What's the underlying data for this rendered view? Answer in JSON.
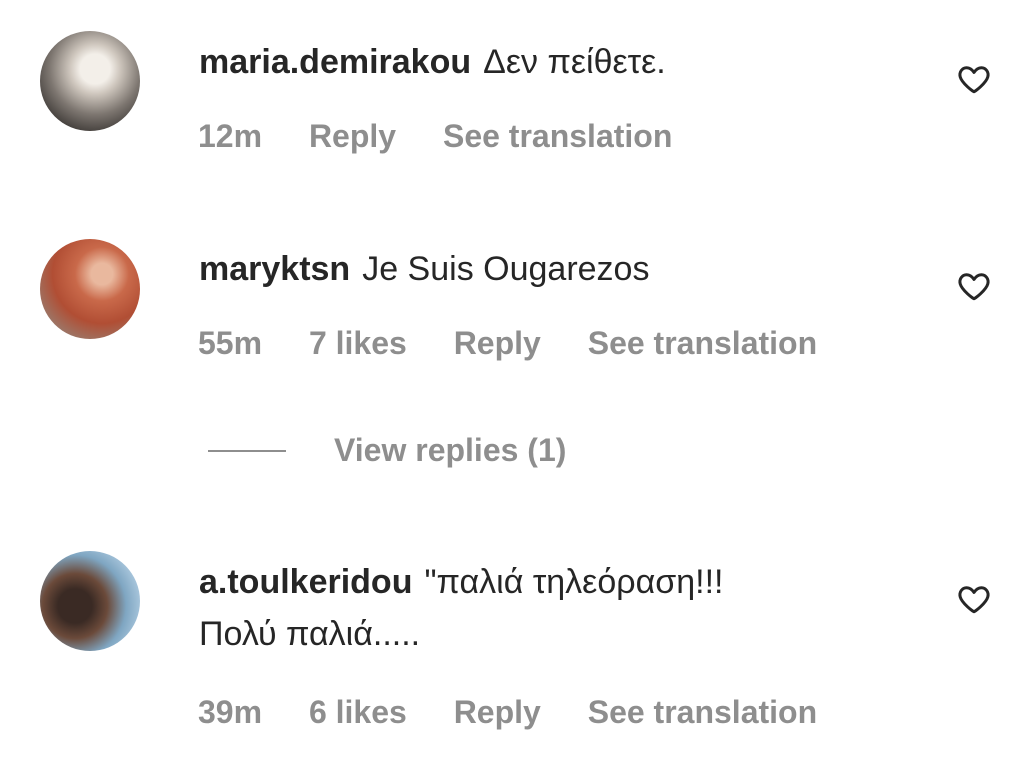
{
  "comments": [
    {
      "username": "maria.demirakou",
      "text": "Δεν πείθετε.",
      "time": "12m",
      "likes": "",
      "reply": "Reply",
      "translate": "See translation",
      "avatar_icon": "avatar-photo",
      "like_icon": "heart-outline-icon"
    },
    {
      "username": "maryktsn",
      "text": "Je Suis Ougarezos",
      "time": "55m",
      "likes": "7 likes",
      "reply": "Reply",
      "translate": "See translation",
      "avatar_icon": "avatar-photo",
      "like_icon": "heart-outline-icon",
      "view_replies": "View replies (1)"
    },
    {
      "username": "a.toulkeridou",
      "text_line1": "\"παλιά τηλεόραση!!!",
      "text_line2": "Πολύ παλιά.....",
      "time": "39m",
      "likes": "6 likes",
      "reply": "Reply",
      "translate": "See translation",
      "avatar_icon": "avatar-photo",
      "like_icon": "heart-outline-icon"
    }
  ],
  "colors": {
    "text": "#262626",
    "secondary": "#8e8e8e",
    "background": "#ffffff"
  }
}
